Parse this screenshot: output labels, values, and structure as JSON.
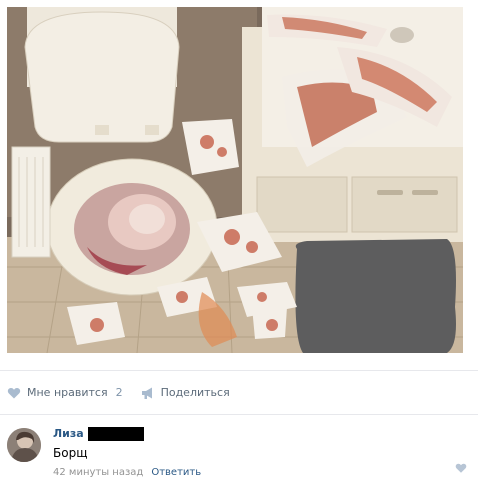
{
  "post": {
    "photo": {
      "icon": "photo-bathroom-mess"
    },
    "actions": {
      "like": {
        "label": "Мне нравится",
        "count": "2",
        "icon": "heart-icon"
      },
      "share": {
        "label": "Поделиться",
        "icon": "megaphone-icon"
      }
    }
  },
  "comment": {
    "author": "Лиза",
    "text": "Борщ",
    "time": "42 минуты назад",
    "reply_label": "Ответить",
    "like_icon": "heart-icon"
  },
  "colors": {
    "link": "#2a5885",
    "action_text": "#5c6b7a",
    "icon": "#a9bbcf",
    "divider": "#e7e8ec"
  }
}
